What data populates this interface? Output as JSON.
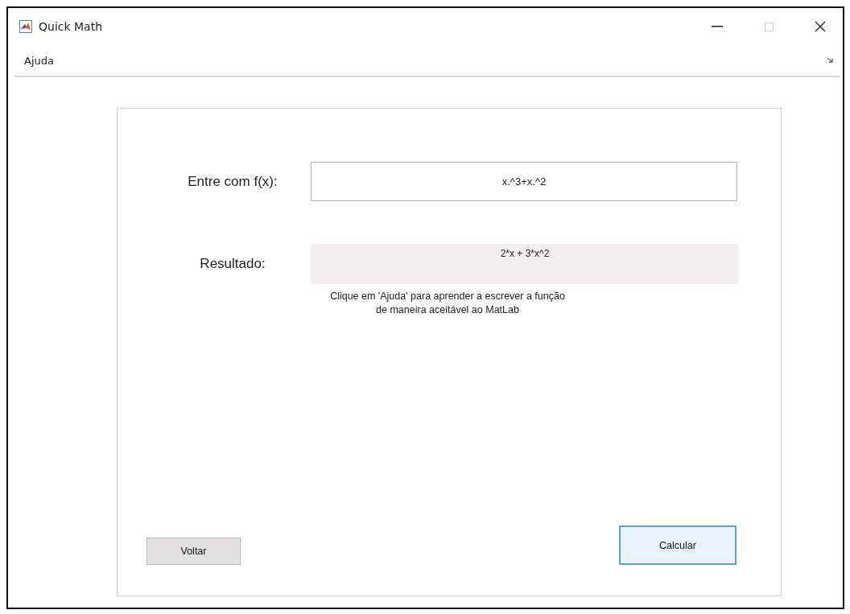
{
  "window": {
    "title": "Quick Math",
    "maximize_disabled": true
  },
  "menu": [
    {
      "label": "Ajuda"
    }
  ],
  "input": {
    "label": "Entre com f(x):",
    "value": "x.^3+x.^2"
  },
  "result": {
    "label": "Resultado:",
    "value": "2*x + 3*x^2"
  },
  "note": "Clique em 'Ajuda' para aprender a escrever a função\nde maneira aceitável ao MatLab",
  "buttons": [
    {
      "label": "Voltar",
      "focused": false
    },
    {
      "label": "Calcular",
      "focused": true
    }
  ]
}
